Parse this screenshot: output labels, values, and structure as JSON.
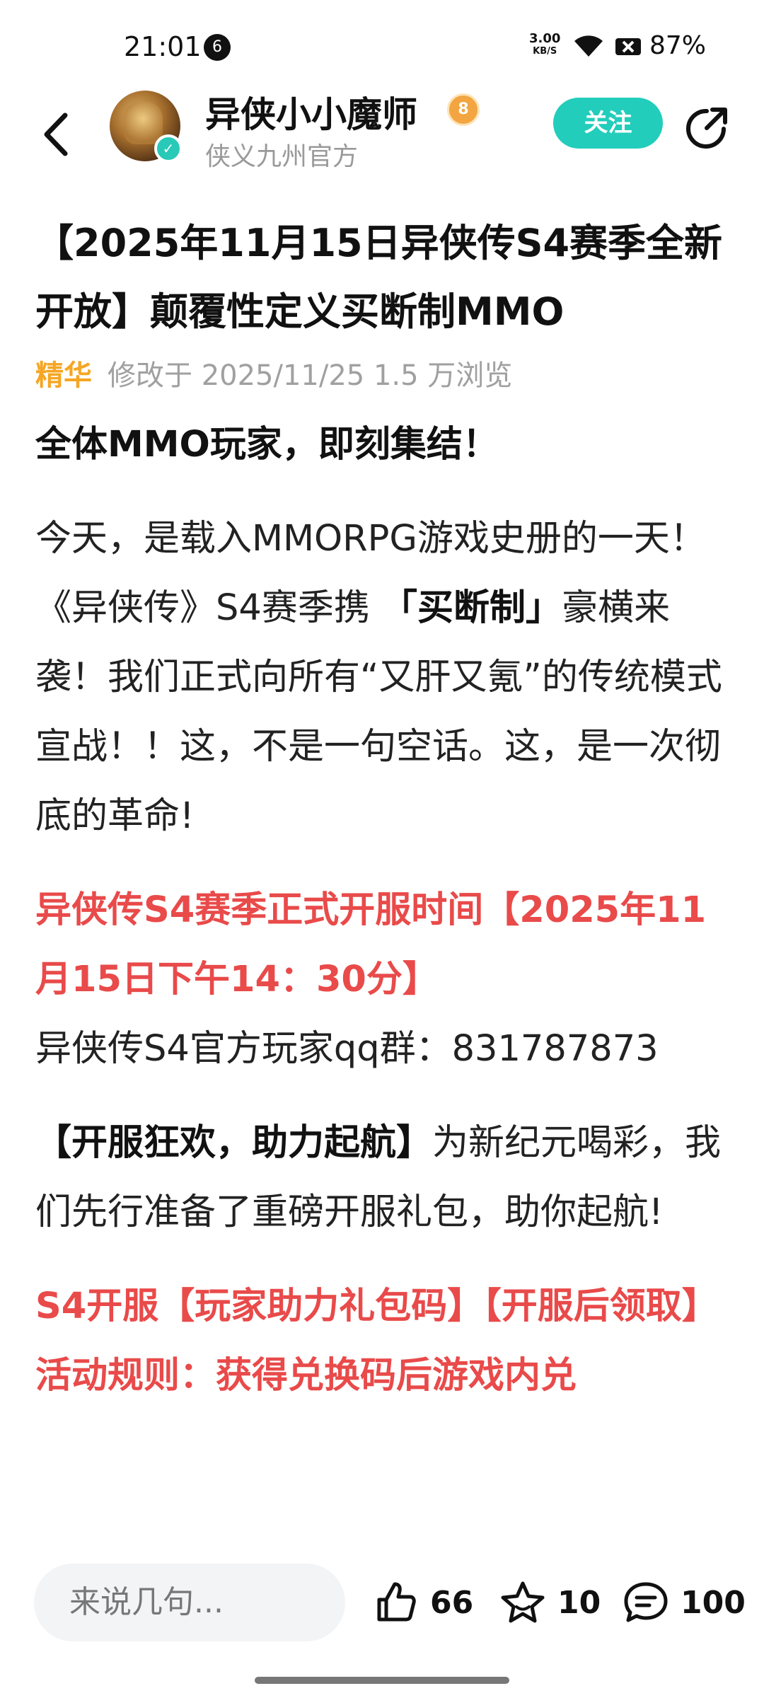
{
  "status_bar": {
    "time": "21:01",
    "notification_count": "6",
    "speed_top": "3.00",
    "speed_bottom": "KB/S",
    "battery": "87%"
  },
  "header": {
    "user_name": "异侠小小魔师",
    "level": "8",
    "subtitle": "侠义九州官方",
    "follow_label": "关注"
  },
  "article": {
    "title": "【2025年11月15日异侠传S4赛季全新开放】颠覆性定义买断制MMO",
    "tag": "精华",
    "meta": "修改于 2025/11/25  1.5 万浏览",
    "heading": "全体MMO玩家，即刻集结！",
    "p1_a": "今天，是载入MMORPG游戏史册的一天！《异侠传》S4赛季携 ",
    "p1_bold": "「买断制」",
    "p1_b": "豪横来袭！我们正式向所有“又肝又氪”的传统模式宣战！！这，不是一句空话。这，是一次彻底的革命!",
    "p2_red": "异侠传S4赛季正式开服时间【2025年11月15日下午14：30分】",
    "p2_line": "异侠传S4官方玩家qq群：831787873",
    "p3_bold": "【开服狂欢，助力起航】",
    "p3_text": "为新纪元喝彩，我们先行准备了重磅开服礼包，助你起航!",
    "p4_red": "S4开服【玩家助力礼包码】【开服后领取】",
    "p5_red": "活动规则：获得兑换码后游戏内兑"
  },
  "bottom_bar": {
    "comment_placeholder": "来说几句...",
    "likes": "66",
    "favorites": "10",
    "comments": "100"
  },
  "colors": {
    "accent": "#22cdbb",
    "highlight_red": "#e94a4a",
    "tag_orange": "#f5a623"
  }
}
